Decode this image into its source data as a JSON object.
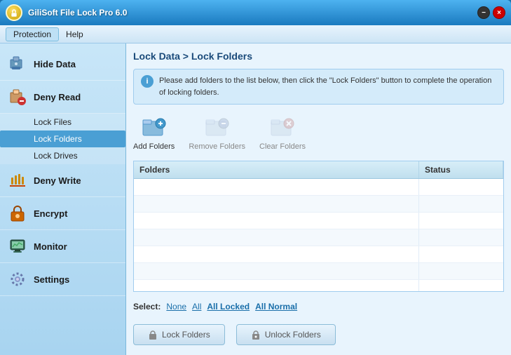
{
  "app": {
    "title": "GiliSoft File Lock Pro 6.0",
    "minimize_label": "−",
    "close_label": "×"
  },
  "menubar": {
    "items": [
      {
        "label": "Protection",
        "active": true
      },
      {
        "label": "Help",
        "active": false
      }
    ]
  },
  "sidebar": {
    "items": [
      {
        "id": "hide-data",
        "label": "Hide Data",
        "icon": "hide-icon"
      },
      {
        "id": "deny-read",
        "label": "Deny Read",
        "icon": "deny-read-icon",
        "children": [
          {
            "id": "lock-files",
            "label": "Lock Files",
            "active": false
          },
          {
            "id": "lock-folders",
            "label": "Lock Folders",
            "active": true
          },
          {
            "id": "lock-drives",
            "label": "Lock Drives",
            "active": false
          }
        ]
      },
      {
        "id": "deny-write",
        "label": "Deny Write",
        "icon": "deny-write-icon"
      },
      {
        "id": "encrypt",
        "label": "Encrypt",
        "icon": "encrypt-icon"
      },
      {
        "id": "monitor",
        "label": "Monitor",
        "icon": "monitor-icon"
      },
      {
        "id": "settings",
        "label": "Settings",
        "icon": "settings-icon"
      }
    ]
  },
  "content": {
    "breadcrumb": "Lock Data > Lock Folders",
    "info_text": "Please add folders to the list below, then click the \"Lock Folders\" button to complete the operation of locking folders.",
    "toolbar": {
      "add_label": "Add Folders",
      "remove_label": "Remove Folders",
      "clear_label": "Clear Folders"
    },
    "table": {
      "columns": [
        {
          "id": "folders",
          "label": "Folders"
        },
        {
          "id": "status",
          "label": "Status"
        }
      ],
      "rows": []
    },
    "select": {
      "label": "Select:",
      "options": [
        {
          "id": "none",
          "label": "None"
        },
        {
          "id": "all",
          "label": "All"
        },
        {
          "id": "all-locked",
          "label": "All Locked"
        },
        {
          "id": "all-normal",
          "label": "All Normal"
        }
      ]
    },
    "buttons": {
      "lock_label": "Lock Folders",
      "unlock_label": "Unlock Folders"
    }
  }
}
